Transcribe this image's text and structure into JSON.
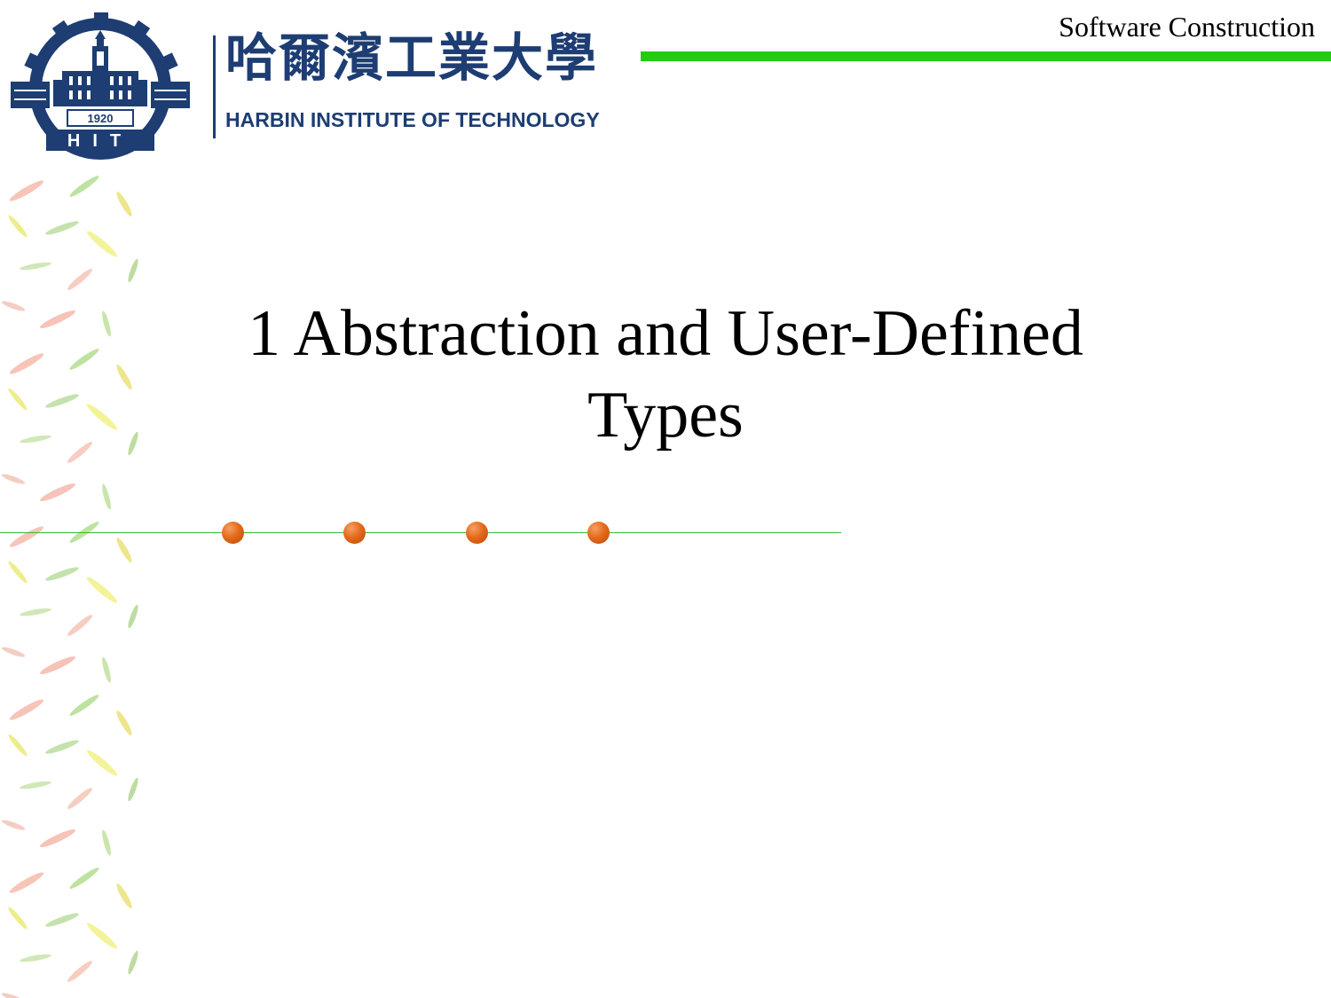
{
  "header": {
    "course_name": "Software Construction",
    "logo": {
      "chinese_name": "哈爾濱工業大學",
      "english_name": "HARBIN INSTITUTE OF TECHNOLOGY",
      "seal_year": "1920",
      "seal_letters": "HIT"
    }
  },
  "slide": {
    "title_line1": "1 Abstraction and User-Defined",
    "title_line2": "Types"
  },
  "colors": {
    "accent_green": "#22cc11",
    "logo_navy": "#1d3d73",
    "bullet_orange": "#e56a1a"
  }
}
